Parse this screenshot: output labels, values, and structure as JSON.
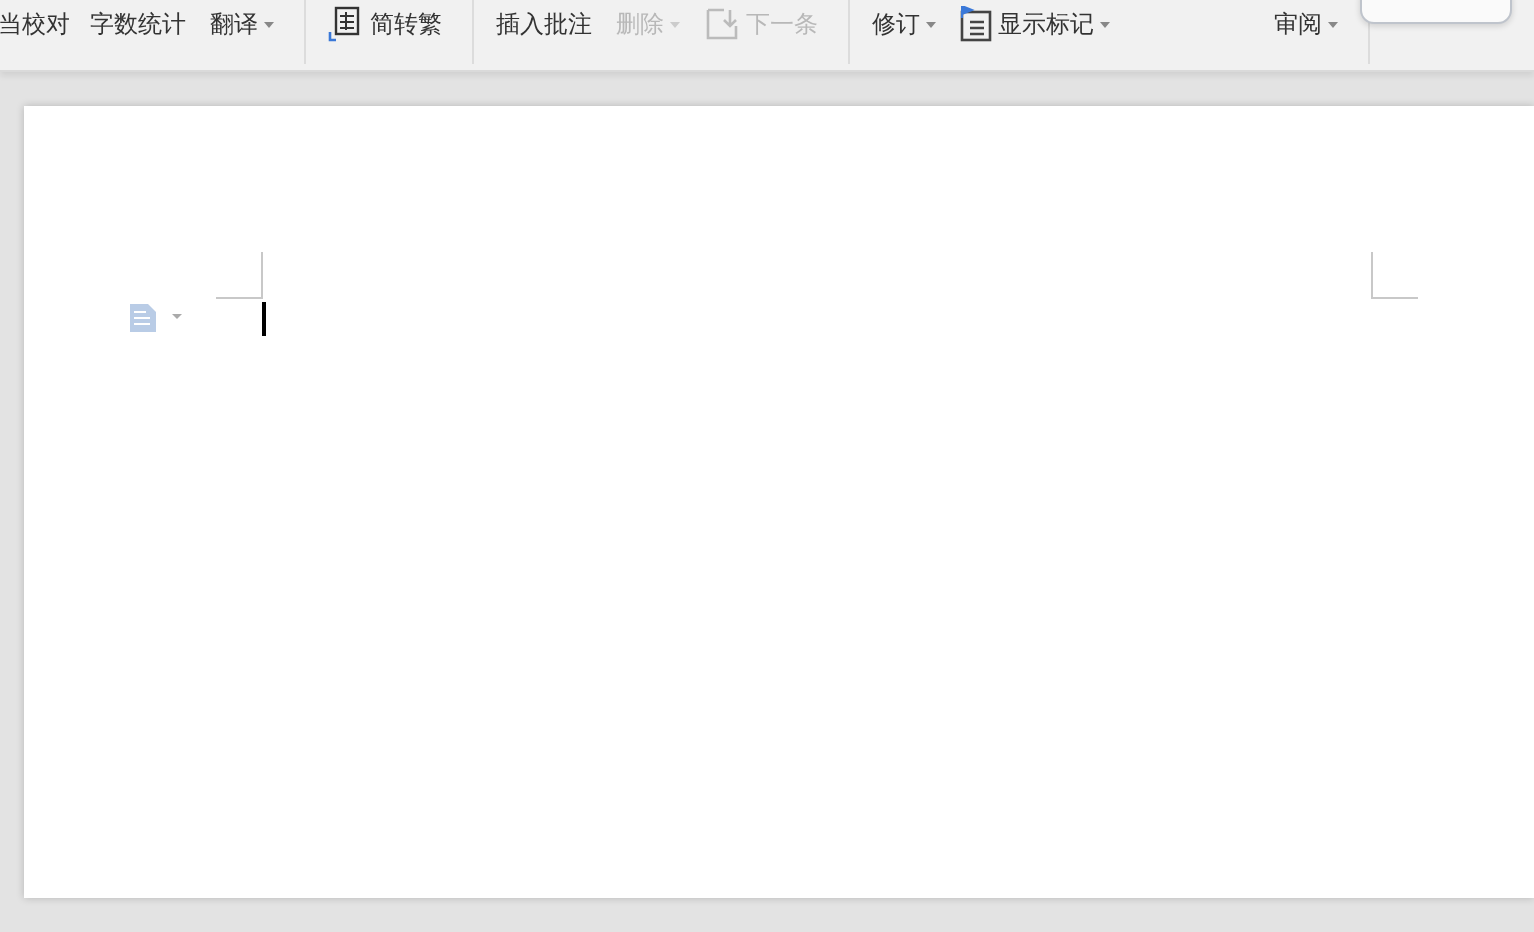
{
  "toolbar": [
    {
      "kind": "text",
      "label": "当校对",
      "disabled": false,
      "caret": false
    },
    {
      "kind": "text",
      "label": "字数统计",
      "disabled": false,
      "caret": false
    },
    {
      "kind": "text",
      "label": "翻译",
      "disabled": false,
      "caret": true
    },
    {
      "kind": "separator"
    },
    {
      "kind": "convert",
      "label": "简转繁",
      "disabled": false,
      "caret": false
    },
    {
      "kind": "separator"
    },
    {
      "kind": "text",
      "label": "插入批注",
      "disabled": false,
      "caret": false
    },
    {
      "kind": "text",
      "label": "删除",
      "disabled": true,
      "caret": true
    },
    {
      "kind": "next",
      "label": "下一条",
      "disabled": true,
      "caret": false
    },
    {
      "kind": "separator"
    },
    {
      "kind": "text",
      "label": "修订",
      "disabled": false,
      "caret": true
    },
    {
      "kind": "markup",
      "label": "显示标记",
      "disabled": false,
      "caret": true
    },
    {
      "kind": "spacer"
    },
    {
      "kind": "text",
      "label": "审阅",
      "disabled": false,
      "caret": true
    },
    {
      "kind": "separator"
    }
  ]
}
